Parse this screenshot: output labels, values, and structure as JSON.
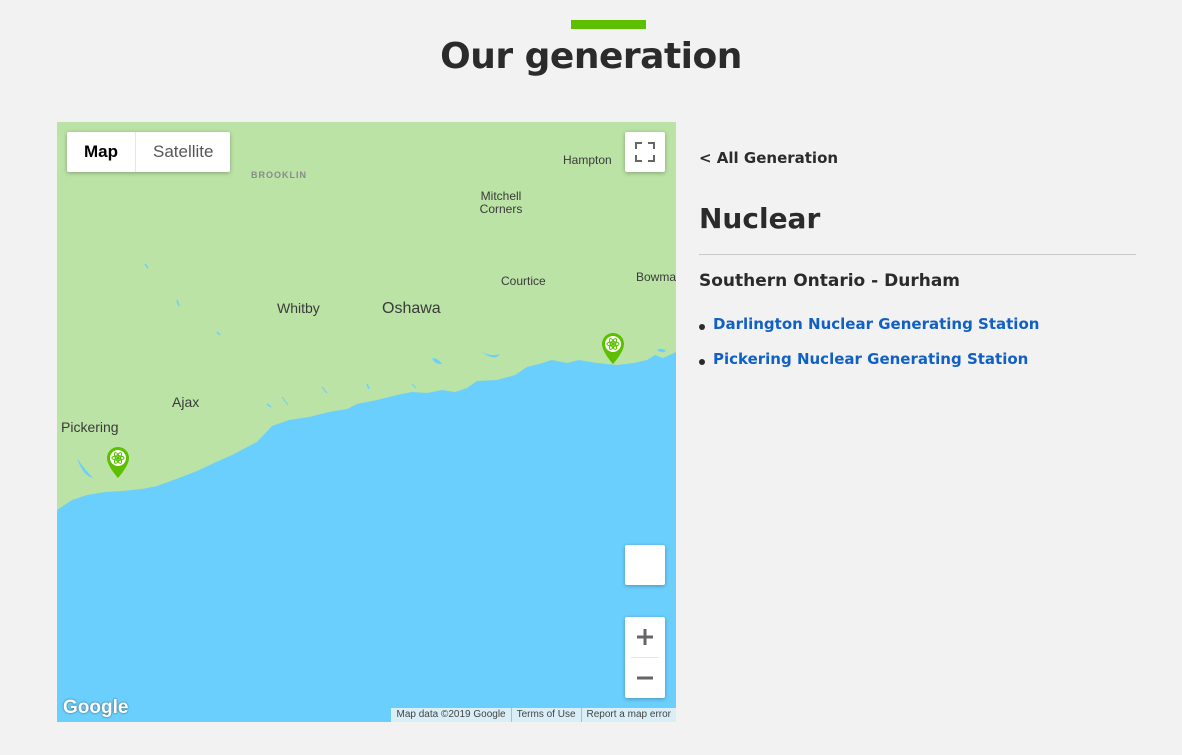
{
  "page": {
    "title": "Our generation",
    "accent_color": "#5cc000"
  },
  "map": {
    "type_buttons": {
      "map": "Map",
      "satellite": "Satellite"
    },
    "places": {
      "brooklin": "BROOKLIN",
      "hampton": "Hampton",
      "mitchell_corners": "Mitchell Corners",
      "courtice": "Courtice",
      "bowmanville": "Bowma",
      "whitby": "Whitby",
      "oshawa": "Oshawa",
      "ajax": "Ajax",
      "pickering": "Pickering"
    },
    "markers": [
      "Pickering Nuclear Generating Station",
      "Darlington Nuclear Generating Station"
    ],
    "logo": "Google",
    "attribution": {
      "data": "Map data ©2019 Google",
      "terms": "Terms of Use",
      "report": "Report a map error"
    },
    "colors": {
      "land": "#bbe3a5",
      "water": "#6bcffe",
      "marker": "#5cc000"
    },
    "icons": [
      "fullscreen-icon",
      "pegman-icon",
      "zoom-in-icon",
      "zoom-out-icon",
      "nuclear-marker-icon"
    ]
  },
  "panel": {
    "back_label": "< All Generation",
    "title": "Nuclear",
    "region": "Southern Ontario - Durham",
    "stations": [
      {
        "label": "Darlington Nuclear Generating Station"
      },
      {
        "label": "Pickering Nuclear Generating Station"
      }
    ],
    "link_color": "#1160c4"
  }
}
